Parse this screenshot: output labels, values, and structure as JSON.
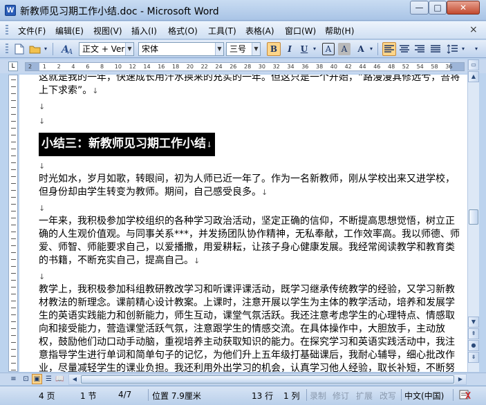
{
  "window": {
    "title": "新教师见习期工作小结.doc - Microsoft Word",
    "minimize": "—",
    "maximize": "□",
    "close": "✕"
  },
  "menu": {
    "items": [
      "文件(F)",
      "编辑(E)",
      "视图(V)",
      "插入(I)",
      "格式(O)",
      "工具(T)",
      "表格(A)",
      "窗口(W)",
      "帮助(H)"
    ],
    "close": "×"
  },
  "toolbar": {
    "style": "正文 + Ver",
    "font": "宋体",
    "size": "三号",
    "bold": "B",
    "italic": "I",
    "underline": "U",
    "char_border": "A",
    "char_shading": "A",
    "aa": "A"
  },
  "ruler": {
    "numbers": [
      "2",
      "1",
      "2",
      "4",
      "6",
      "8",
      "10",
      "12",
      "14",
      "16",
      "18",
      "20",
      "22",
      "24",
      "26",
      "28",
      "30",
      "32",
      "34",
      "36",
      "38",
      "40",
      "42",
      "44",
      "46",
      "48",
      "52",
      "54",
      "58",
      "36"
    ]
  },
  "document": {
    "line_top": "这就是我的一年，快速成长用汗水换来的充实的一年。但这只是一个开始，“路漫漫其修远兮，吾将上下求索”。",
    "heading": "小结三：新教师见习期工作小结",
    "p1": "时光如水，岁月如歌，转眼间，初为人师已近一年了。作为一名新教师，刚从学校出来又进学校，但身份却由学生转变为教师。期间，自己感受良多。",
    "p2": "一年来，我积极参加学校组织的各种学习政治活动，坚定正确的信仰，不断提高思想觉悟，树立正确的人生观价值观。与同事关系***，并发扬团队协作精神，无私奉献，工作效率高。我以师德、师爱、师智、师能要求自己，以爱播撒，用爱耕耘，让孩子身心健康发展。我经常阅读教学和教育类的书籍，不断充实自己，提高自己。",
    "p3": "教学上，我积极参加科组教研教改学习和听课评课活动，既学习继承传统教学的经验，又学习新教材教法的新理念。课前精心设计教案。上课时，注意开展以学生为主体的教学活动，培养和发展学生的英语实践能力和创新能力，师生互动，课堂气氛活跃。我还注意考虑学生的心理特点、情感取向和接受能力，营造课堂活跃气氛，注意跟学生的情感交流。在具体操作中，大胆放手，主动放权，鼓励他们动口动手动脑，重视培养主动获取知识的能力。在探究学习和英语实践活动中，我注意指导学生进行单词和简单句子的记忆，为他们升上五年级打基础课后，我耐心辅导，细心批改作业，尽量减轻学生的课业负担。我还利用外出学习的机会，认真学习他人经验，取长补短，不断努力提高业务水平。",
    "para_mark": "↓",
    "empty_mark": "↓"
  },
  "status": {
    "page": "4 页",
    "section": "1 节",
    "pages": "4/7",
    "position": "位置 7.9厘米",
    "line": "13 行",
    "column": "1 列",
    "rec": "录制",
    "trk": "修订",
    "ext": "扩展",
    "ovr": "改写",
    "language": "中文(中国)"
  }
}
